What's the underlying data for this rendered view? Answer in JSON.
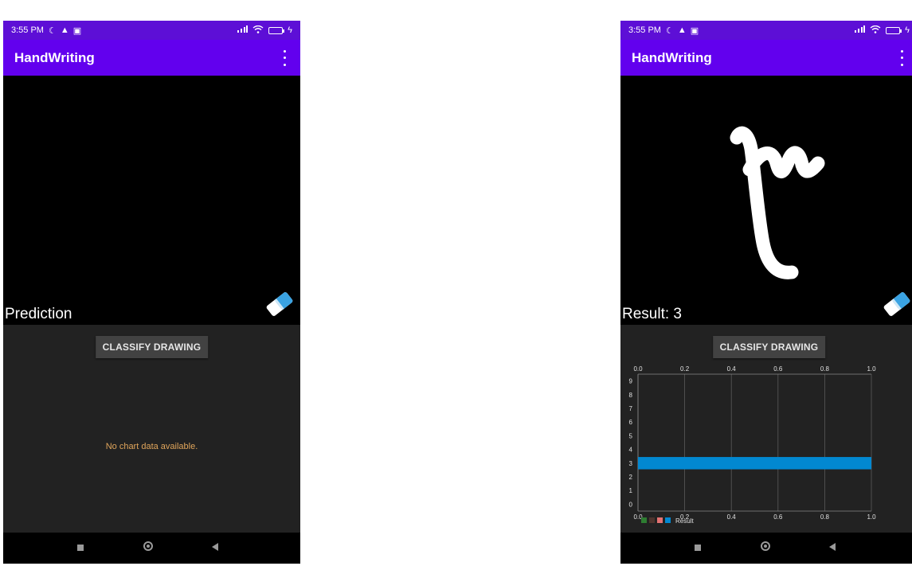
{
  "status_bar": {
    "time": "3:55 PM"
  },
  "app_bar": {
    "title": "HandWriting"
  },
  "left_screen": {
    "label": "Prediction",
    "classify_button": "CLASSIFY DRAWING",
    "no_chart_message": "No chart data available."
  },
  "right_screen": {
    "label": "Result: 3",
    "classify_button": "CLASSIFY DRAWING",
    "drawn_glyph": "۳"
  },
  "icons": {
    "status_left": [
      "moon-icon",
      "warning-icon",
      "camera-icon"
    ],
    "status_right": [
      "signal-icon",
      "wifi-icon",
      "battery-icon",
      "charging-icon"
    ],
    "eraser": "eraser-icon",
    "overflow": "more-vert-icon",
    "nav": [
      "recents-square-icon",
      "home-circle-icon",
      "back-triangle-icon"
    ]
  },
  "colors": {
    "status_bar": "#5d0fd6",
    "app_bar": "#6200ee",
    "panel": "#222222",
    "bar": "#0288d1",
    "no_data_text": "#e0a55b"
  },
  "chart_data": {
    "type": "bar",
    "orientation": "horizontal",
    "categories": [
      "0",
      "1",
      "2",
      "3",
      "4",
      "5",
      "6",
      "7",
      "8",
      "9"
    ],
    "series": [
      {
        "name": "Result",
        "values": [
          0,
          0,
          0,
          1.0,
          0,
          0,
          0,
          0,
          0,
          0
        ],
        "color": "#0288d1"
      }
    ],
    "value_ticks": [
      "0.0",
      "0.2",
      "0.4",
      "0.6",
      "0.8",
      "1.0"
    ],
    "xlim": [
      0,
      1.0
    ],
    "grid": true,
    "legend": {
      "position": "bottom-left",
      "swatch_colors": [
        "#2e7d32",
        "#4e342e",
        "#e57373",
        "#0288d1"
      ]
    }
  }
}
